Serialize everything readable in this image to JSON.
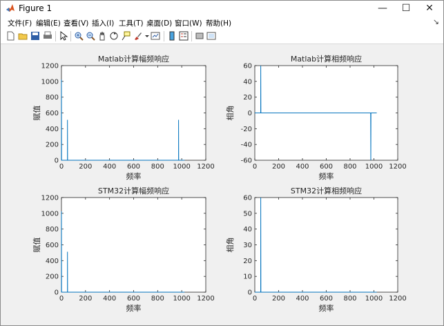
{
  "window": {
    "title": "Figure 1"
  },
  "controls": {
    "minimize": "—",
    "maximize": "☐",
    "close": "✕"
  },
  "menu": [
    "文件(F)",
    "编辑(E)",
    "查看(V)",
    "插入(I)",
    "工具(T)",
    "桌面(D)",
    "窗口(W)",
    "帮助(H)"
  ],
  "toolbar": [
    "new-figure-icon",
    "open-file-icon",
    "save-icon",
    "print-icon",
    "pointer-icon",
    "zoom-in-icon",
    "zoom-out-icon",
    "pan-icon",
    "rotate-3d-icon",
    "data-cursor-icon",
    "brush-icon",
    "link-plot-icon",
    "colorbar-icon",
    "legend-icon",
    "hide-plot-tools-icon",
    "show-plot-tools-icon"
  ],
  "chart_data": [
    {
      "type": "line",
      "title": "Matlab计算幅频响应",
      "xlabel": "频率",
      "ylabel": "赋值",
      "xlim": [
        0,
        1200
      ],
      "ylim": [
        0,
        1200
      ],
      "xticks": [
        "0",
        "200",
        "400",
        "600",
        "800",
        "1000",
        "1200"
      ],
      "yticks": [
        "0",
        "200",
        "400",
        "600",
        "800",
        "1000",
        "1200"
      ],
      "x": [
        0,
        0,
        1,
        50,
        50,
        51,
        974,
        974,
        975,
        1024
      ],
      "y": [
        0,
        1024,
        0,
        0,
        512,
        0,
        0,
        512,
        0,
        0
      ]
    },
    {
      "type": "line",
      "title": "Matlab计算相频响应",
      "xlabel": "频率",
      "ylabel": "相角",
      "xlim": [
        0,
        1200
      ],
      "ylim": [
        -60,
        60
      ],
      "xticks": [
        "0",
        "200",
        "400",
        "600",
        "800",
        "1000",
        "1200"
      ],
      "yticks": [
        "-60",
        "-40",
        "-20",
        "0",
        "20",
        "40",
        "60"
      ],
      "x": [
        0,
        49,
        50,
        50,
        51,
        973,
        974,
        974,
        975,
        1024
      ],
      "y": [
        0,
        0,
        60,
        60,
        0,
        0,
        -60,
        -60,
        0,
        0
      ]
    },
    {
      "type": "line",
      "title": "STM32计算幅频响应",
      "xlabel": "频率",
      "ylabel": "赋值",
      "xlim": [
        0,
        1200
      ],
      "ylim": [
        0,
        1200
      ],
      "xticks": [
        "0",
        "200",
        "400",
        "600",
        "800",
        "1000",
        "1200"
      ],
      "yticks": [
        "0",
        "200",
        "400",
        "600",
        "800",
        "1000",
        "1200"
      ],
      "x": [
        0,
        0,
        1,
        50,
        50,
        51,
        1024
      ],
      "y": [
        0,
        1024,
        0,
        0,
        512,
        0,
        0
      ]
    },
    {
      "type": "line",
      "title": "STM32计算相频响应",
      "xlabel": "频率",
      "ylabel": "相角",
      "xlim": [
        0,
        1200
      ],
      "ylim": [
        0,
        60
      ],
      "xticks": [
        "0",
        "200",
        "400",
        "600",
        "800",
        "1000",
        "1200"
      ],
      "yticks": [
        "0",
        "10",
        "20",
        "30",
        "40",
        "50",
        "60"
      ],
      "x": [
        0,
        49,
        50,
        50,
        51,
        1024
      ],
      "y": [
        0,
        0,
        60,
        60,
        0,
        0
      ]
    }
  ],
  "colors": {
    "line": "#0072BD",
    "axis": "#262626",
    "plot_bg": "#ffffff",
    "figure_bg": "#f0f0f0"
  }
}
